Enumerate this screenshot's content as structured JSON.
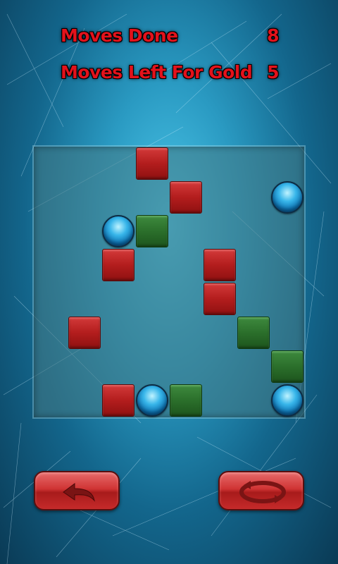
{
  "stats": {
    "moves_done_label": "Moves Done",
    "moves_done_value": "8",
    "moves_left_label": "Moves Left For Gold",
    "moves_left_value": "5"
  },
  "board": {
    "cols": 8,
    "rows": 8,
    "pieces": [
      {
        "type": "red",
        "col": 3,
        "row": 0
      },
      {
        "type": "red",
        "col": 4,
        "row": 1
      },
      {
        "type": "ball",
        "col": 7,
        "row": 1
      },
      {
        "type": "ball",
        "col": 2,
        "row": 2
      },
      {
        "type": "green",
        "col": 3,
        "row": 2
      },
      {
        "type": "red",
        "col": 2,
        "row": 3
      },
      {
        "type": "red",
        "col": 5,
        "row": 3
      },
      {
        "type": "red",
        "col": 5,
        "row": 4
      },
      {
        "type": "red",
        "col": 1,
        "row": 5
      },
      {
        "type": "green",
        "col": 6,
        "row": 5
      },
      {
        "type": "green",
        "col": 7,
        "row": 6
      },
      {
        "type": "red",
        "col": 2,
        "row": 7
      },
      {
        "type": "ball",
        "col": 3,
        "row": 7
      },
      {
        "type": "green",
        "col": 4,
        "row": 7
      },
      {
        "type": "ball",
        "col": 7,
        "row": 7
      }
    ]
  },
  "buttons": {
    "undo_icon": "undo-arrow-icon",
    "reset_icon": "reset-cycle-icon"
  },
  "colors": {
    "label_text": "#e3121b",
    "red_block": "#b31d1d",
    "green_block": "#2b6f2b",
    "ball": "#38b6ea",
    "button": "#d03434"
  }
}
